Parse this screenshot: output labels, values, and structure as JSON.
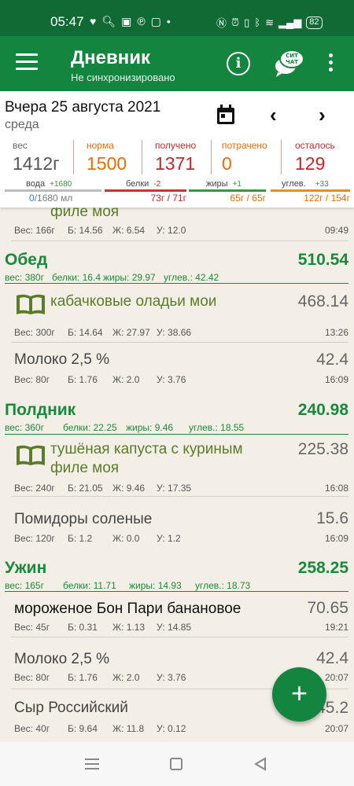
{
  "status_bar": {
    "time": "05:47",
    "battery": "82"
  },
  "app_bar": {
    "title": "Дневник",
    "subtitle": "Не синхронизировано",
    "chat_icon_text": "СИТ ЧАТ"
  },
  "date": {
    "main": "Вчера 25 августа 2021",
    "weekday": "среда"
  },
  "stats": {
    "weight": {
      "label": "вес",
      "value": "1412г"
    },
    "norm": {
      "label": "норма",
      "value": "1500"
    },
    "received": {
      "label": "получено",
      "value": "1371"
    },
    "spent": {
      "label": "потрачено",
      "value": "0"
    },
    "left": {
      "label": "осталось",
      "value": "129"
    }
  },
  "bars": {
    "water": {
      "label": "вода",
      "delta": "+1680",
      "current": "0",
      "total": "/1680 мл",
      "color": "#1e88c8"
    },
    "protein": {
      "label": "белки",
      "delta": "-2",
      "value": "73г / 71г",
      "color": "#d32f2f"
    },
    "fat": {
      "label": "жиры",
      "delta": "+1",
      "value": "65г / 65г",
      "color": "#2e9e3a"
    },
    "carbs": {
      "label": "углев.",
      "delta": "+33",
      "value": "122г / 154г",
      "color": "#ef8a1c"
    }
  },
  "entries": {
    "e0": {
      "name": "филе моя",
      "macros": {
        "w": "Вес: 166г",
        "p": "Б: 14.56",
        "f": "Ж: 6.54",
        "c": "У: 12.0"
      },
      "time": "09:49"
    },
    "lunch": {
      "title": "Обед",
      "kcal": "510.54",
      "w": "вес: 380г",
      "p": "белки: 16.4",
      "f": "жиры: 29.97",
      "c": "углев.: 42.42"
    },
    "e1": {
      "name": "кабачковые оладьи мои",
      "kcal": "468.14",
      "macros": {
        "w": "Вес: 300г",
        "p": "Б: 14.64",
        "f": "Ж: 27.97",
        "c": "У: 38.66"
      },
      "time": "13:26"
    },
    "e2": {
      "name": "Молоко 2,5 %",
      "kcal": "42.4",
      "macros": {
        "w": "Вес: 80г",
        "p": "Б: 1.76",
        "f": "Ж: 2.0",
        "c": "У: 3.76"
      },
      "time": "16:09"
    },
    "snack": {
      "title": "Полдник",
      "kcal": "240.98",
      "w": "вес: 360г",
      "p": "белки: 22.25",
      "f": "жиры: 9.46",
      "c": "углев.: 18.55"
    },
    "e3": {
      "name": "тушёная капуста с куриным филе моя",
      "kcal": "225.38",
      "macros": {
        "w": "Вес: 240г",
        "p": "Б: 21.05",
        "f": "Ж: 9.46",
        "c": "У: 17.35"
      },
      "time": "16:08"
    },
    "e4": {
      "name": "Помидоры соленые",
      "kcal": "15.6",
      "macros": {
        "w": "Вес: 120г",
        "p": "Б: 1.2",
        "f": "Ж: 0.0",
        "c": "У: 1.2"
      },
      "time": "16:09"
    },
    "dinner": {
      "title": "Ужин",
      "kcal": "258.25",
      "w": "вес: 165г",
      "p": "белки: 11.71",
      "f": "жиры: 14.93",
      "c": "углев.: 18.73"
    },
    "e5": {
      "name": "мороженое Бон Пари банановое",
      "kcal": "70.65",
      "macros": {
        "w": "Вес: 45г",
        "p": "Б: 0.31",
        "f": "Ж: 1.13",
        "c": "У: 14.85"
      },
      "time": "19:21"
    },
    "e6": {
      "name": "Молоко 2,5 %",
      "kcal": "42.4",
      "macros": {
        "w": "Вес: 80г",
        "p": "Б: 1.76",
        "f": "Ж: 2.0",
        "c": "У: 3.76"
      },
      "time": "20:07"
    },
    "e7": {
      "name": "Сыр Российский",
      "kcal": "45.2",
      "macros": {
        "w": "Вес: 40г",
        "p": "Б: 9.64",
        "f": "Ж: 11.8",
        "c": "У: 0.12"
      },
      "time": "20:07"
    }
  },
  "fab": {
    "label": "+"
  },
  "icons": [
    "menu-icon",
    "info-icon",
    "chat-icon",
    "more-vert-icon",
    "calendar-icon",
    "chevron-left-icon",
    "chevron-right-icon",
    "recipe-book-icon",
    "add-icon"
  ]
}
